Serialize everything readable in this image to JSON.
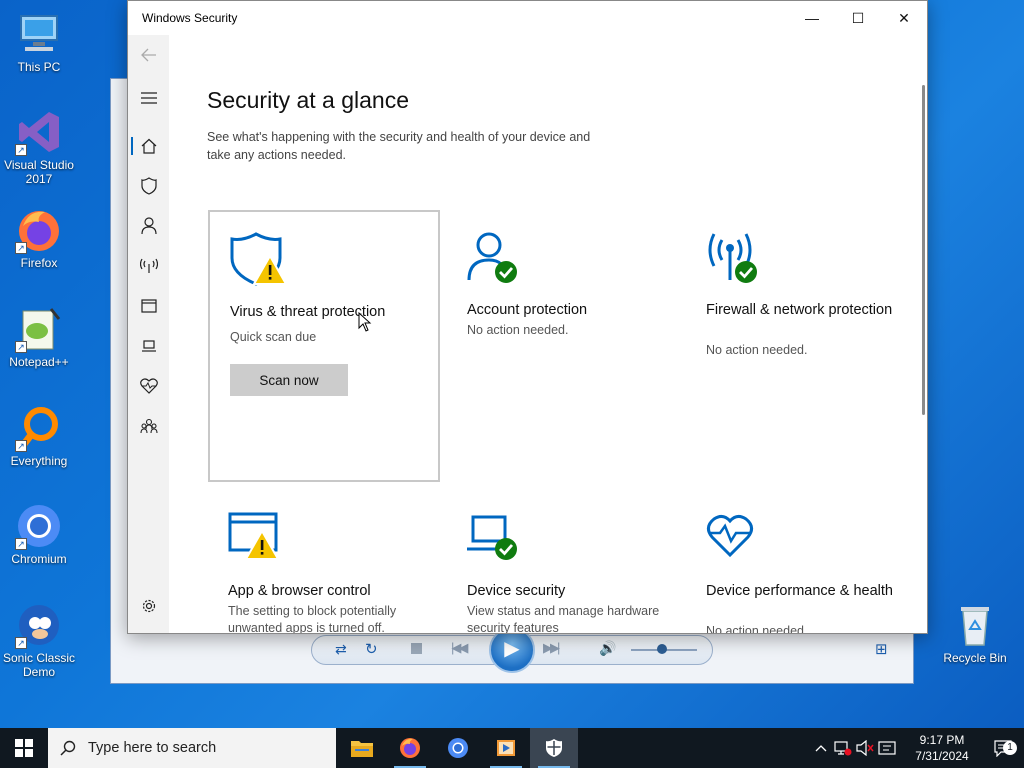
{
  "desktop": {
    "icons": [
      {
        "label": "This PC"
      },
      {
        "label": "Visual Studio 2017"
      },
      {
        "label": "Firefox"
      },
      {
        "label": "Notepad++"
      },
      {
        "label": "Everything"
      },
      {
        "label": "Chromium"
      },
      {
        "label": "Sonic Classic Demo"
      },
      {
        "label": "Recycle Bin"
      }
    ]
  },
  "window": {
    "title": "Windows Security",
    "minimize": "—",
    "maximize": "☐",
    "close": "✕"
  },
  "page": {
    "heading": "Security at a glance",
    "subtitle": "See what's happening with the security and health of your device and take any actions needed."
  },
  "tiles": [
    {
      "name": "Virus & threat protection",
      "status": "Quick scan due",
      "button": "Scan now",
      "icon": "shield-warning-icon"
    },
    {
      "name": "Account protection",
      "status": "No action needed.",
      "icon": "account-check-icon"
    },
    {
      "name": "Firewall & network protection",
      "status": "No action needed.",
      "icon": "firewall-check-icon"
    },
    {
      "name": "App & browser control",
      "status": "The setting to block potentially unwanted apps is turned off.",
      "icon": "browser-warning-icon"
    },
    {
      "name": "Device security",
      "status": "View status and manage hardware security features",
      "icon": "laptop-check-icon"
    },
    {
      "name": "Device performance & health",
      "status": "No action needed.",
      "icon": "heart-monitor-icon"
    }
  ],
  "taskbar": {
    "search_placeholder": "Type here to search",
    "time": "9:17 PM",
    "date": "7/31/2024",
    "notifications_count": "1"
  },
  "colors": {
    "accent": "#0067c0",
    "check": "#107c10",
    "warning": "#f5c400"
  }
}
